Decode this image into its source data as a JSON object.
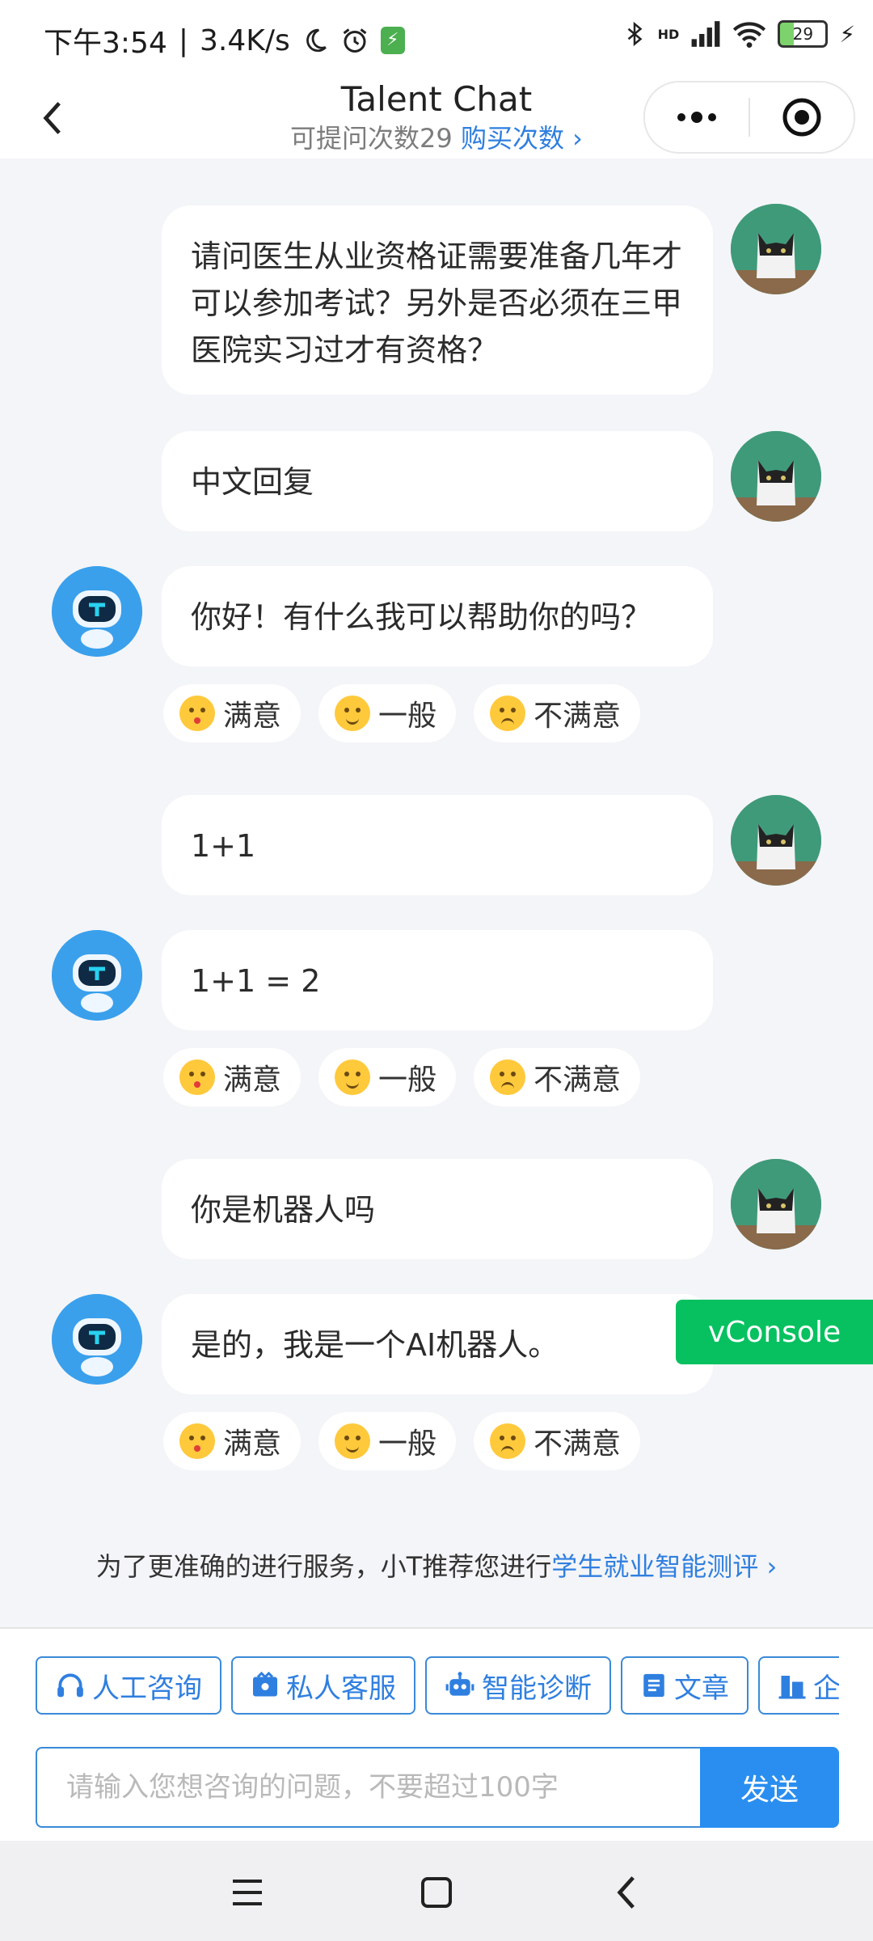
{
  "status_bar": {
    "time": "下午3:54",
    "speed": "3.4K/s",
    "battery": "29",
    "network": "HD"
  },
  "header": {
    "title": "Talent Chat",
    "questions_left": "可提问次数29",
    "buy_label": "购买次数"
  },
  "messages": [
    {
      "role": "user",
      "text": "请问医生从业资格证需要准备几年才可以参加考试？另外是否必须在三甲医院实习过才有资格？"
    },
    {
      "role": "user",
      "text": "中文回复"
    },
    {
      "role": "bot",
      "text": "你好！有什么我可以帮助你的吗？"
    },
    {
      "role": "user",
      "text": "1+1"
    },
    {
      "role": "bot",
      "text": "1+1 = 2"
    },
    {
      "role": "user",
      "text": "你是机器人吗"
    },
    {
      "role": "bot",
      "text": "是的，我是一个AI机器人。"
    }
  ],
  "reactions": {
    "satisfied": "满意",
    "neutral": "一般",
    "unsatisfied": "不满意"
  },
  "vconsole_label": "vConsole",
  "recommend": {
    "text": "为了更准确的进行服务，小T推荐您进行",
    "link": "学生就业智能测评"
  },
  "toolbar": [
    {
      "label": "人工咨询",
      "icon": "headset-icon"
    },
    {
      "label": "私人客服",
      "icon": "service-icon"
    },
    {
      "label": "智能诊断",
      "icon": "robot-icon"
    },
    {
      "label": "文章",
      "icon": "article-icon"
    },
    {
      "label": "企",
      "icon": "building-icon"
    }
  ],
  "input": {
    "placeholder": "请输入您想咨询的问题，不要超过100字",
    "value": ""
  },
  "send_label": "发送",
  "colors": {
    "accent": "#2f7fe0",
    "send_bg": "#2a8ef0",
    "vconsole": "#07c160",
    "page_bg": "#f4f5f8"
  }
}
